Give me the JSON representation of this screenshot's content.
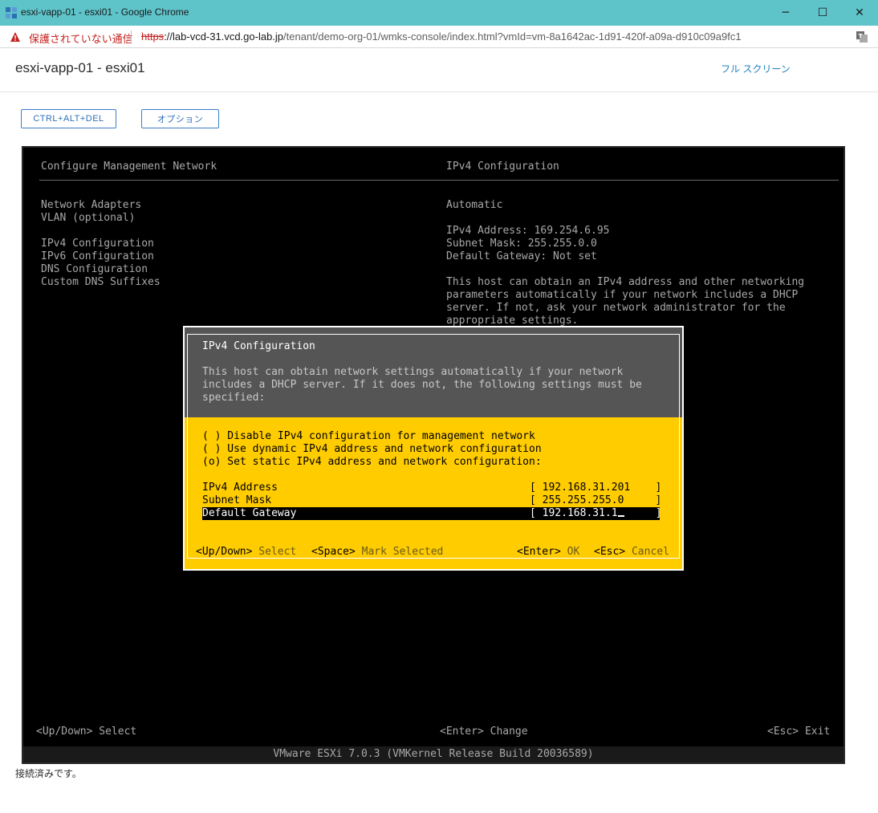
{
  "window": {
    "title": "esxi-vapp-01 - esxi01 - Google Chrome",
    "minimize": "─",
    "maximize": "☐",
    "close": "✕"
  },
  "addressbar": {
    "security_label": "保護されていない通信",
    "scheme": "https",
    "host_prefix": "://lab-vcd-31.vcd.go-lab.jp",
    "path": "/tenant/demo-org-01/wmks-console/index.html?vmId=vm-8a1642ac-1d91-420f-a09a-d910c09a9fc1"
  },
  "page": {
    "title": "esxi-vapp-01 - esxi01",
    "fullscreen_label": "フル スクリーン",
    "ctrl_alt_del_label": "CTRL+ALT+DEL",
    "options_label": "オプション",
    "status": "接続済みです。"
  },
  "console": {
    "left_header": "Configure Management Network",
    "right_header": "IPv4 Configuration",
    "menu": [
      "Network Adapters",
      "VLAN (optional)",
      "IPv4 Configuration",
      "IPv6 Configuration",
      "DNS Configuration",
      "Custom DNS Suffixes"
    ],
    "right_mode": "Automatic",
    "right_details": [
      "IPv4 Address: 169.254.6.95",
      "Subnet Mask: 255.255.0.0",
      "Default Gateway: Not set"
    ],
    "right_desc": [
      "This host can obtain an IPv4 address and other networking",
      "parameters automatically if your network includes a DHCP",
      "server. If not, ask your network administrator for the",
      "appropriate settings."
    ],
    "footer_left": "<Up/Down> Select",
    "footer_center": "<Enter> Change",
    "footer_right": "<Esc> Exit",
    "version_bar": "VMware ESXi 7.0.3 (VMKernel Release Build 20036589)"
  },
  "dialog": {
    "title": "IPv4 Configuration",
    "desc": [
      "This host can obtain network settings automatically if your network",
      "includes a DHCP server. If it does not, the following settings must be",
      "specified:"
    ],
    "options": [
      "( ) Disable IPv4 configuration for management network",
      "( ) Use dynamic IPv4 address and network configuration",
      "(o) Set static IPv4 address and network configuration:"
    ],
    "fields": [
      {
        "label": "IPv4 Address",
        "value": "192.168.31.201"
      },
      {
        "label": "Subnet Mask",
        "value": "255.255.255.0"
      },
      {
        "label": "Default Gateway",
        "value": "192.168.31.1"
      }
    ],
    "help": {
      "updown_key": "<Up/Down>",
      "updown_desc": "Select",
      "space_key": "<Space>",
      "space_desc": "Mark Selected",
      "enter_key": "<Enter>",
      "enter_desc": "OK",
      "esc_key": "<Esc>",
      "esc_desc": "Cancel"
    }
  }
}
